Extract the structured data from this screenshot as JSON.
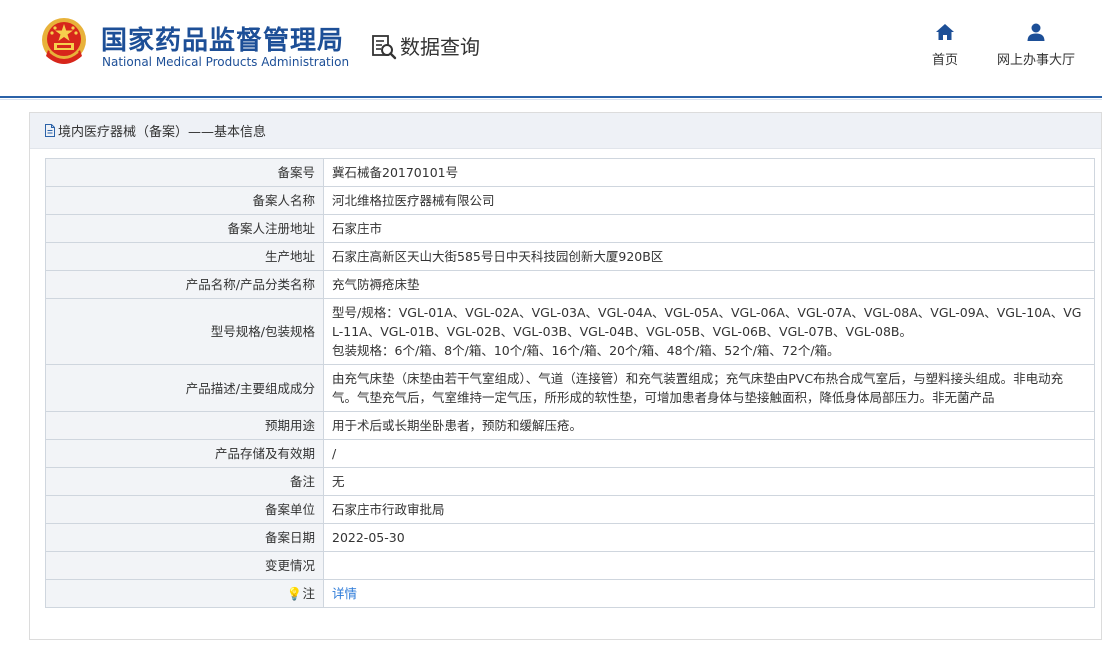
{
  "header": {
    "site_name_cn": "国家药品监督管理局",
    "site_name_en": "National Medical Products Administration",
    "data_query_label": "数据查询",
    "nav": [
      {
        "label": "首页",
        "icon": "home-icon"
      },
      {
        "label": "网上办事大厅",
        "icon": "user-icon"
      }
    ]
  },
  "panel": {
    "title": "境内医疗器械（备案）——基本信息"
  },
  "record": {
    "rows": [
      {
        "key": "备案号",
        "value": "冀石械备20170101号"
      },
      {
        "key": "备案人名称",
        "value": "河北维格拉医疗器械有限公司"
      },
      {
        "key": "备案人注册地址",
        "value": "石家庄市"
      },
      {
        "key": "生产地址",
        "value": "石家庄高新区天山大街585号日中天科技园创新大厦920B区"
      },
      {
        "key": "产品名称/产品分类名称",
        "value": "充气防褥疮床垫"
      },
      {
        "key": "型号规格/包装规格",
        "value": "型号/规格：VGL-01A、VGL-02A、VGL-03A、VGL-04A、VGL-05A、VGL-06A、VGL-07A、VGL-08A、VGL-09A、VGL-10A、VGL-11A、VGL-01B、VGL-02B、VGL-03B、VGL-04B、VGL-05B、VGL-06B、VGL-07B、VGL-08B。\n包装规格：6个/箱、8个/箱、10个/箱、16个/箱、20个/箱、48个/箱、52个/箱、72个/箱。"
      },
      {
        "key": "产品描述/主要组成成分",
        "value": "由充气床垫（床垫由若干气室组成）、气道（连接管）和充气装置组成；充气床垫由PVC布热合成气室后，与塑料接头组成。非电动充气。气垫充气后，气室维持一定气压，所形成的软性垫，可增加患者身体与垫接触面积，降低身体局部压力。非无菌产品"
      },
      {
        "key": "预期用途",
        "value": "用于术后或长期坐卧患者，预防和缓解压疮。"
      },
      {
        "key": "产品存储及有效期",
        "value": "/"
      },
      {
        "key": "备注",
        "value": "无"
      },
      {
        "key": "备案单位",
        "value": "石家庄市行政审批局"
      },
      {
        "key": "备案日期",
        "value": "2022-05-30"
      },
      {
        "key": "变更情况",
        "value": ""
      },
      {
        "key": "注",
        "value": "详情"
      }
    ]
  }
}
